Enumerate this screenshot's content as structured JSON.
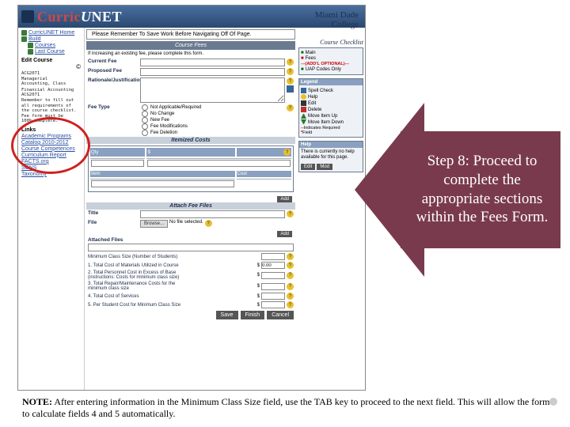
{
  "app_title": {
    "t1": "Curric",
    "t2": "U",
    "t3": "NET"
  },
  "college": "Miami Dade\nCollege",
  "sidebar": {
    "home": "CurricUNET Home",
    "build": "Build",
    "courses": "Courses",
    "last": "Last Course",
    "edit_course": "Edit Course",
    "mono1": "ACG2071\nManagerial\nAccounting, Class",
    "mono2": "Financial Accounting\nACG2071\nRemember to fill out\nall requirements of\nthe course checklist.\nFee form must be\n100% complete.",
    "links_label": "Links",
    "links": [
      "Academic Programs",
      "Catalog 2010-2012",
      "Course Competences",
      "Curriculum Report",
      "FACTS.org",
      "SCNS",
      "Taxonomy"
    ]
  },
  "right": {
    "checklist_title": "Course Checklist",
    "checklist": {
      "main": "Main",
      "fees": "Fees",
      "dash": "---(ADD'L OPTIONAL)---",
      "uap": "UAP Codes Only"
    },
    "legend_title": "Legend",
    "legend": {
      "spell": "Spell Check",
      "help": "Help",
      "edit": "Edit",
      "delete": "Delete",
      "moveup": "Move Item Up",
      "movedn": "Move Item Down",
      "req1": "Indicates Required",
      "req2": "Field",
      "dash1": "--",
      "dash2": "*"
    },
    "help_title": "Help",
    "help_text": "There is currently no help available for this page.",
    "edit_btn": "Edit",
    "mod_btn": "Mod"
  },
  "form": {
    "reminder": "Please Remember To Save Work Before Navigating Off Of Page.",
    "bar_fees": "Course Fees",
    "instr": "If increasing an existing fee, please complete this form.",
    "current_fee": "Current Fee",
    "proposed_fee": "Proposed Fee",
    "rationale": "Rationale/Justification",
    "fee_type": "Fee Type",
    "radios": [
      "Not Applicable/Required",
      "No Change",
      "New Fee",
      "Fee Modifications",
      "Fee Deletion"
    ],
    "bar_itemized": "Itemized Costs",
    "col_qty": "Qty",
    "col_dollar": "$",
    "col_item": "Item",
    "col_cost": "Cost",
    "add_btn": "Add",
    "bar_attach": "Attach Fee Files",
    "title_label": "Title",
    "file_label": "File",
    "browse_btn": "Browse...",
    "browse_ph": "No file selected.",
    "attached_files": "Attached Files",
    "num1": "Minimum Class Size (Number of Students)",
    "num2": "1. Total Cost of Materials Utilized in Course",
    "num3": "2. Total Personnel Cost in Excess of Base\n(instructions: Costs for minimum class size)",
    "num4": "3. Total Repair/Maintenance Costs for the\nminimum class size",
    "num5": "4. Total Cost of Services",
    "num6": "5. Per Student Cost for Minimum Class Size",
    "v1": "",
    "v2": "0.00",
    "v3": "",
    "v4": "",
    "v5": "",
    "v6": "",
    "save": "Save",
    "finish": "Finish",
    "cancel": "Cancel"
  },
  "callout": "Step 8: Proceed to complete the appropriate sections within the Fees Form.",
  "note": {
    "bold": "NOTE:",
    "body": " After entering information in the Minimum Class Size field, use the TAB key to proceed to the next field. This will allow the form to calculate fields 4 and 5 automatically."
  }
}
